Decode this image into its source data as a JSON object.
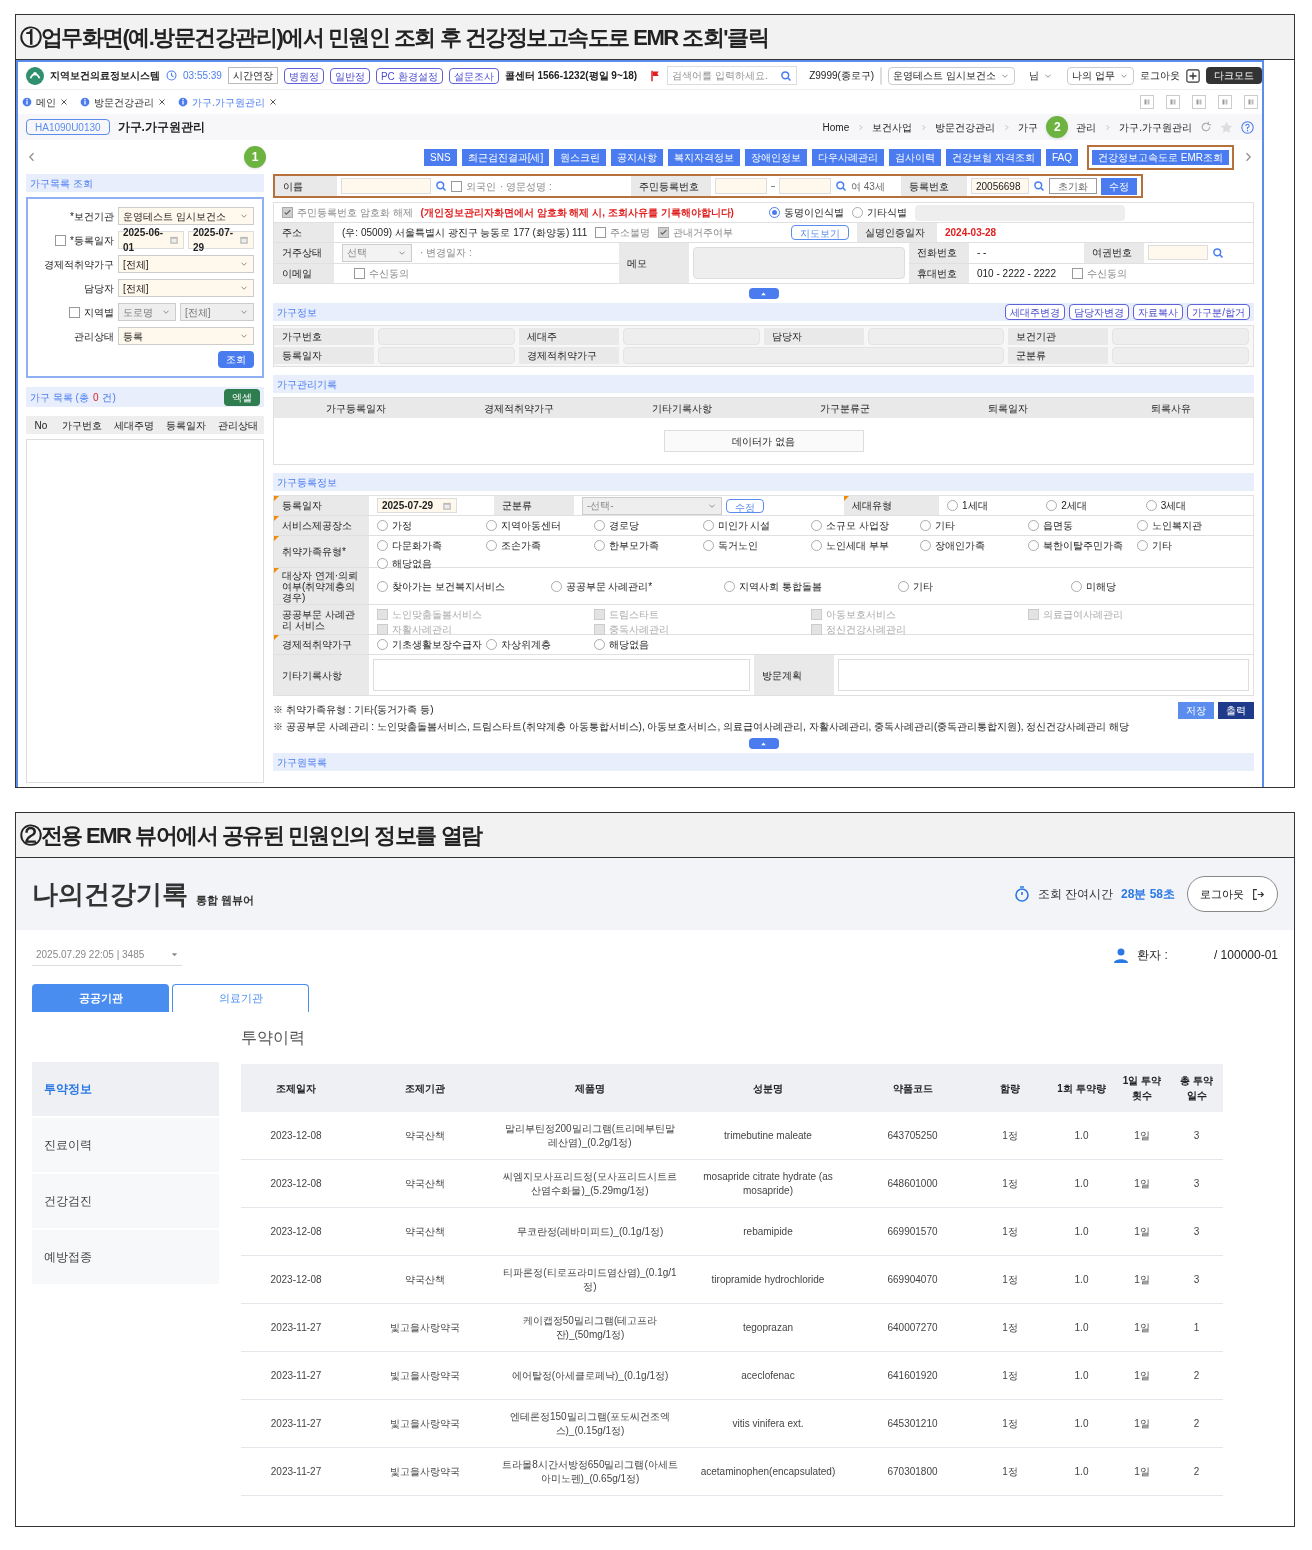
{
  "caption_1": "①업무화면(예.방문건강관리)에서 민원인 조회 후 건강정보고속도로 EMR 조회'클릭",
  "work_screen": {
    "header": {
      "system_name": "지역보건의료정보시스템",
      "clock": "03:55:39",
      "extend_button": "시간연장",
      "quick_links": [
        "병원정",
        "일반정",
        "PC 환경설정",
        "설문조사"
      ],
      "call_center": "콜센터 1566-1232(평일 9~18)",
      "search": {
        "placeholder": "검색어를 입력하세요."
      },
      "user_org": "Z9999(종로구)",
      "org_select": "운영테스트 임시보건소",
      "user_suffix": "님",
      "menu_select": "나의 업무",
      "logout": "로그아웃",
      "dark_mode": "다크모드"
    },
    "tabs": [
      {
        "label": "메인",
        "selected": false
      },
      {
        "label": "방문건강관리",
        "selected": false
      },
      {
        "label": "가구.가구원관리",
        "selected": true
      }
    ],
    "page": {
      "code": "HA1090U0130",
      "title": "가구.가구원관리",
      "breadcrumb": [
        {
          "kind": "link",
          "text": "Home"
        },
        {
          "kind": "link",
          "text": "보건사업"
        },
        {
          "kind": "link",
          "text": "방문건강관리"
        },
        {
          "kind": "link",
          "text": "가구"
        },
        {
          "kind": "marker",
          "text": "2"
        },
        {
          "kind": "link",
          "text": "관리"
        },
        {
          "kind": "link",
          "text": "가구.가구원관리"
        }
      ]
    },
    "toolbar": {
      "step_marker": "1",
      "buttons": [
        {
          "label": "SNS",
          "highlighted": false
        },
        {
          "label": "최근검진결과[세]",
          "highlighted": false
        },
        {
          "label": "원스크린",
          "highlighted": false
        },
        {
          "label": "공지사항",
          "highlighted": false
        },
        {
          "label": "복지자격정보",
          "highlighted": false
        },
        {
          "label": "장애인정보",
          "highlighted": false
        },
        {
          "label": "다우사례관리",
          "highlighted": false
        },
        {
          "label": "검사이력",
          "highlighted": false
        },
        {
          "label": "건강보험 자격조회",
          "highlighted": false
        },
        {
          "label": "FAQ",
          "highlighted": false
        },
        {
          "label": "건강정보고속도로 EMR조회",
          "highlighted": true
        }
      ]
    },
    "left_panel": {
      "title": "가구목록 조회",
      "fields": [
        {
          "kind": "select",
          "label": "*보건기관",
          "value": "운영테스트 임시보건소"
        },
        {
          "kind": "date_range",
          "label": "*등록일자",
          "checkbox": {
            "checked": false
          },
          "from": "2025-06-01",
          "to": "2025-07-29"
        },
        {
          "kind": "select",
          "label": "경제적취약가구",
          "value": "[전체]"
        },
        {
          "kind": "select",
          "label": "담당자",
          "value": "[전체]"
        },
        {
          "kind": "double_select",
          "label": "지역별",
          "checkbox": {
            "checked": false
          },
          "first": "도로명",
          "second": "[전체]"
        },
        {
          "kind": "select",
          "label": "관리상태",
          "value": "등록"
        }
      ],
      "search_button": "조회",
      "list_title": "가구 목록 (총",
      "list_count": "0",
      "list_unit": "건)",
      "excel_button": "엑셀",
      "columns": [
        "No",
        "가구번호",
        "세대주명",
        "등록일자",
        "관리상태"
      ]
    },
    "right_panel": {
      "search": {
        "name_label": "이름",
        "foreign": {
          "label": "외국인",
          "checked": false
        },
        "english_name_label": "· 영문성명 :",
        "rrn_label": "주민등록번호",
        "age_sex": "여 43세",
        "reg_label": "등록번호",
        "reg_value": "20056698",
        "reset_button": "초기화",
        "edit_button": "수정"
      },
      "decrypt": {
        "label": "주민등록번호 암호화 해제",
        "checked": true,
        "notice": "(개인정보관리자화면에서 암호화 해제 시, 조회사유를 기록해야합니다)",
        "identify_options": [
          {
            "label": "동명이인식별",
            "selected": true
          },
          {
            "label": "기타식별",
            "selected": false
          }
        ]
      },
      "address": {
        "label": "주소",
        "value": "(우: 05009) 서울특별시 광진구 능동로 177 (화양동) 111",
        "checks": [
          {
            "label": "주소불명",
            "checked": false
          },
          {
            "label": "관내거주여부",
            "checked": true
          }
        ],
        "map_button": "지도보기"
      },
      "verified": {
        "label": "실명인증일자",
        "value": "2024-03-28"
      },
      "residence": {
        "label": "거주상태",
        "select": "선택",
        "change_date_label": "· 변경일자 :"
      },
      "memo_label": "메모",
      "phone": {
        "label": "전화번호",
        "value": "-  -"
      },
      "passport_label": "여권번호",
      "email": {
        "label": "이메일",
        "consent": {
          "label": "수신동의",
          "checked": false
        }
      },
      "mobile": {
        "label": "휴대번호",
        "value": "010 - 2222 - 2222",
        "consent": {
          "label": "수신동의",
          "checked": false
        }
      },
      "household_info": {
        "title": "가구정보",
        "buttons": [
          "세대주변경",
          "담당자변경",
          "자료복사",
          "가구분/합거"
        ],
        "labels": [
          "가구번호",
          "세대주",
          "담당자",
          "보건기관",
          "등록일자",
          "경제적취약가구",
          "군분류"
        ]
      },
      "management_record": {
        "title": "가구관리기록",
        "columns": [
          "가구등록일자",
          "경제적취약가구",
          "기타기록사항",
          "가구분류군",
          "퇴록일자",
          "퇴록사유"
        ],
        "empty": "데이터가 없음"
      },
      "registration": {
        "title": "가구등록정보",
        "reg_date": {
          "label": "등록일자",
          "required": true,
          "value": "2025-07-29"
        },
        "group": {
          "label": "군분류",
          "required": false,
          "select": "-선택-",
          "button": "수정"
        },
        "generation": {
          "label": "세대유형",
          "required": true,
          "options": [
            {
              "label": "1세대",
              "selected": false
            },
            {
              "label": "2세대",
              "selected": false
            },
            {
              "label": "3세대",
              "selected": false
            }
          ]
        },
        "radio_rows": [
          {
            "label": "서비스제공장소",
            "required": true,
            "options": [
              {
                "label": "가정",
                "selected": false
              },
              {
                "label": "지역아동센터",
                "selected": false
              },
              {
                "label": "경로당",
                "selected": false
              },
              {
                "label": "미인가 시설",
                "selected": false
              },
              {
                "label": "소규모 사업장",
                "selected": false
              },
              {
                "label": "기타",
                "selected": false
              },
              {
                "label": "읍면동",
                "selected": false
              },
              {
                "label": "노인복지관",
                "selected": false
              }
            ]
          },
          {
            "label": "취약가족유형*",
            "required": true,
            "options": [
              {
                "label": "다문화가족",
                "selected": false
              },
              {
                "label": "조손가족",
                "selected": false
              },
              {
                "label": "한부모가족",
                "selected": false
              },
              {
                "label": "독거노인",
                "selected": false
              },
              {
                "label": "노인세대 부부",
                "selected": false
              },
              {
                "label": "장애인가족",
                "selected": false
              },
              {
                "label": "북한이탈주민가족",
                "selected": false
              },
              {
                "label": "기타",
                "selected": false
              },
              {
                "label": "해당없음",
                "selected": false
              }
            ]
          },
          {
            "label": "대상자 연계·의뢰여부(취약계층의 경우)",
            "required": true,
            "options": [
              {
                "label": "찾아가는 보건복지서비스",
                "selected": false
              },
              {
                "label": "공공부문 사례관리*",
                "selected": false
              },
              {
                "label": "지역사회 통합돌봄",
                "selected": false
              },
              {
                "label": "기타",
                "selected": false
              },
              {
                "label": "미해당",
                "selected": false
              }
            ]
          }
        ],
        "case_management": {
          "label": "공공부문 사례관리 서비스",
          "required": false,
          "items": [
            {
              "label": "노인맞춤돌봄서비스",
              "checked": false,
              "disabled": true
            },
            {
              "label": "드림스타트",
              "checked": false,
              "disabled": true
            },
            {
              "label": "아동보호서비스",
              "checked": false,
              "disabled": true
            },
            {
              "label": "의료급여사례관리",
              "checked": false,
              "disabled": true
            },
            {
              "label": "자활사례관리",
              "checked": false,
              "disabled": true
            },
            {
              "label": "중독사례관리",
              "checked": false,
              "disabled": true
            },
            {
              "label": "정신건강사례관리",
              "checked": false,
              "disabled": true
            }
          ]
        },
        "economic": {
          "label": "경제적취약가구",
          "required": true,
          "options": [
            {
              "label": "기초생활보장수급자",
              "selected": false
            },
            {
              "label": "차상위계층",
              "selected": false
            },
            {
              "label": "해당없음",
              "selected": false
            }
          ]
        },
        "other_notes_label": "기타기록사항",
        "visit_plan_label": "방문계획"
      },
      "notes": [
        "※ 취약가족유형 : 기타(동거가족 등)",
        "※ 공공부문 사례관리 : 노인맞춤돌봄서비스, 드림스타트(취약계층 아동통합서비스), 아동보호서비스, 의료급여사례관리, 자활사례관리, 중독사례관리(중독관리통합지원), 정신건강사례관리 해당"
      ],
      "save_button": "저장",
      "print_button": "출력",
      "next_section": "가구원목록"
    }
  },
  "caption_2": "②전용 EMR 뷰어에서 공유된 민원인의 정보를 열람",
  "emr_viewer": {
    "title": "나의건강기록",
    "subtitle": "통합 웹뷰어",
    "remaining_label": "조회 잔여시간",
    "remaining_time": "28분 58초",
    "logout_button": "로그아웃",
    "record_select": "2025.07.29 22:05 | 3485",
    "patient_label": "환자 :",
    "patient_id": "/ 100000-01",
    "tabs": [
      {
        "label": "공공기관",
        "selected": true
      },
      {
        "label": "의료기관",
        "selected": false
      }
    ],
    "menu": [
      {
        "label": "투약정보",
        "selected": true
      },
      {
        "label": "진료이력",
        "selected": false
      },
      {
        "label": "건강검진",
        "selected": false
      },
      {
        "label": "예방접종",
        "selected": false
      }
    ],
    "section_title": "투약이력",
    "table": {
      "columns": [
        "조제일자",
        "조제기관",
        "제품명",
        "성분명",
        "약품코드",
        "함량",
        "1회 투약량",
        "1일 투약횟수",
        "총 투약일수"
      ],
      "rows": [
        [
          "2023-12-08",
          "약국산책",
          "말리부틴정200밀리그램(트리메부틴말레산염)_(0.2g/1정)",
          "trimebutine maleate",
          "643705250",
          "1정",
          "1.0",
          "1일",
          "3"
        ],
        [
          "2023-12-08",
          "약국산책",
          "씨엠지모사프리드정(모사프리드시트르산염수화물)_(5.29mg/1정)",
          "mosapride citrate hydrate (as mosapride)",
          "648601000",
          "1정",
          "1.0",
          "1일",
          "3"
        ],
        [
          "2023-12-08",
          "약국산책",
          "무코란정(레바미피드)_(0.1g/1정)",
          "rebamipide",
          "669901570",
          "1정",
          "1.0",
          "1일",
          "3"
        ],
        [
          "2023-12-08",
          "약국산책",
          "티파론정(티로프라미드염산염)_(0.1g/1정)",
          "tiropramide hydrochloride",
          "669904070",
          "1정",
          "1.0",
          "1일",
          "3"
        ],
        [
          "2023-11-27",
          "빛고을사랑약국",
          "케이캡정50밀리그램(테고프라잔)_(50mg/1정)",
          "tegoprazan",
          "640007270",
          "1정",
          "1.0",
          "1일",
          "1"
        ],
        [
          "2023-11-27",
          "빛고을사랑약국",
          "에어탈정(아세클로페낙)_(0.1g/1정)",
          "aceclofenac",
          "641601920",
          "1정",
          "1.0",
          "1일",
          "2"
        ],
        [
          "2023-11-27",
          "빛고을사랑약국",
          "엔테론정150밀리그램(포도씨건조엑스)_(0.15g/1정)",
          "vitis vinifera ext.",
          "645301210",
          "1정",
          "1.0",
          "1일",
          "2"
        ],
        [
          "2023-11-27",
          "빛고을사랑약국",
          "트라몰8시간서방정650밀리그램(아세트아미노펜)_(0.65g/1정)",
          "acetaminophen(encapsulated)",
          "670301800",
          "1정",
          "1.0",
          "1일",
          "2"
        ]
      ]
    }
  }
}
